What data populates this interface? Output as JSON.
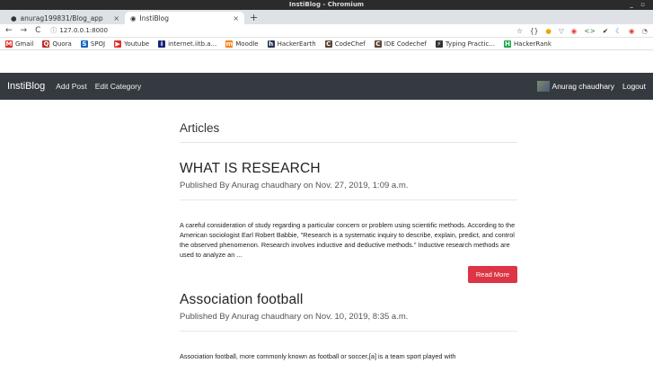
{
  "window": {
    "title": "InstiBlog - Chromium",
    "controls": "_ ▫"
  },
  "tabs": [
    {
      "title": "anurag199831/Blog_app",
      "close": "×"
    },
    {
      "title": "InstiBlog",
      "close": "×"
    }
  ],
  "newtab": "+",
  "toolbar": {
    "back": "←",
    "forward": "→",
    "reload": "C",
    "info": "ⓘ",
    "url": "127.0.0.1:8000",
    "extensions": [
      "☆",
      "{}",
      "●",
      "▽",
      "◉",
      "<>",
      "✔",
      "☾",
      "◉",
      "◔"
    ]
  },
  "bookmarks": [
    {
      "label": "Gmail",
      "icon": "M",
      "color": "#d93025"
    },
    {
      "label": "Quora",
      "icon": "Q",
      "color": "#b92b27"
    },
    {
      "label": "SPOJ",
      "icon": "S",
      "color": "#1565c0"
    },
    {
      "label": "Youtube",
      "icon": "▶",
      "color": "#e52d27"
    },
    {
      "label": "internet.iitb.a...",
      "icon": "i",
      "color": "#1a237e"
    },
    {
      "label": "Moodle",
      "icon": "m",
      "color": "#f98012"
    },
    {
      "label": "HackerEarth",
      "icon": "h",
      "color": "#2c3454"
    },
    {
      "label": "CodeChef",
      "icon": "C",
      "color": "#5b4638"
    },
    {
      "label": "IDE Codechef",
      "icon": "C",
      "color": "#5b4638"
    },
    {
      "label": "Typing Practic...",
      "icon": "⚡",
      "color": "#333333"
    },
    {
      "label": "HackerRank",
      "icon": "H",
      "color": "#1ba94c"
    }
  ],
  "navbar": {
    "brand": "InstiBlog",
    "links": [
      "Add Post",
      "Edit Category"
    ],
    "user": "Anurag chaudhary",
    "logout": "Logout"
  },
  "page": {
    "title": "Articles"
  },
  "posts": [
    {
      "title": "WHAT IS RESEARCH",
      "meta": "Published By Anurag chaudhary on Nov. 27, 2019, 1:09 a.m.",
      "body": "A careful consideration of study regarding a particular concern or problem using scientific methods. According to the American sociologist Earl Robert Babbie, \"Research is a systematic inquiry to describe, explain, predict, and control the observed phenomenon. Research involves inductive and deductive methods.\" Inductive research methods are used to analyze an ...",
      "button": "Read More"
    },
    {
      "title": "Association football",
      "meta": "Published By Anurag chaudhary on Nov. 10, 2019, 8:35 a.m.",
      "body": "Association football, more commonly known as football or soccer,[a] is a team sport played with"
    }
  ]
}
